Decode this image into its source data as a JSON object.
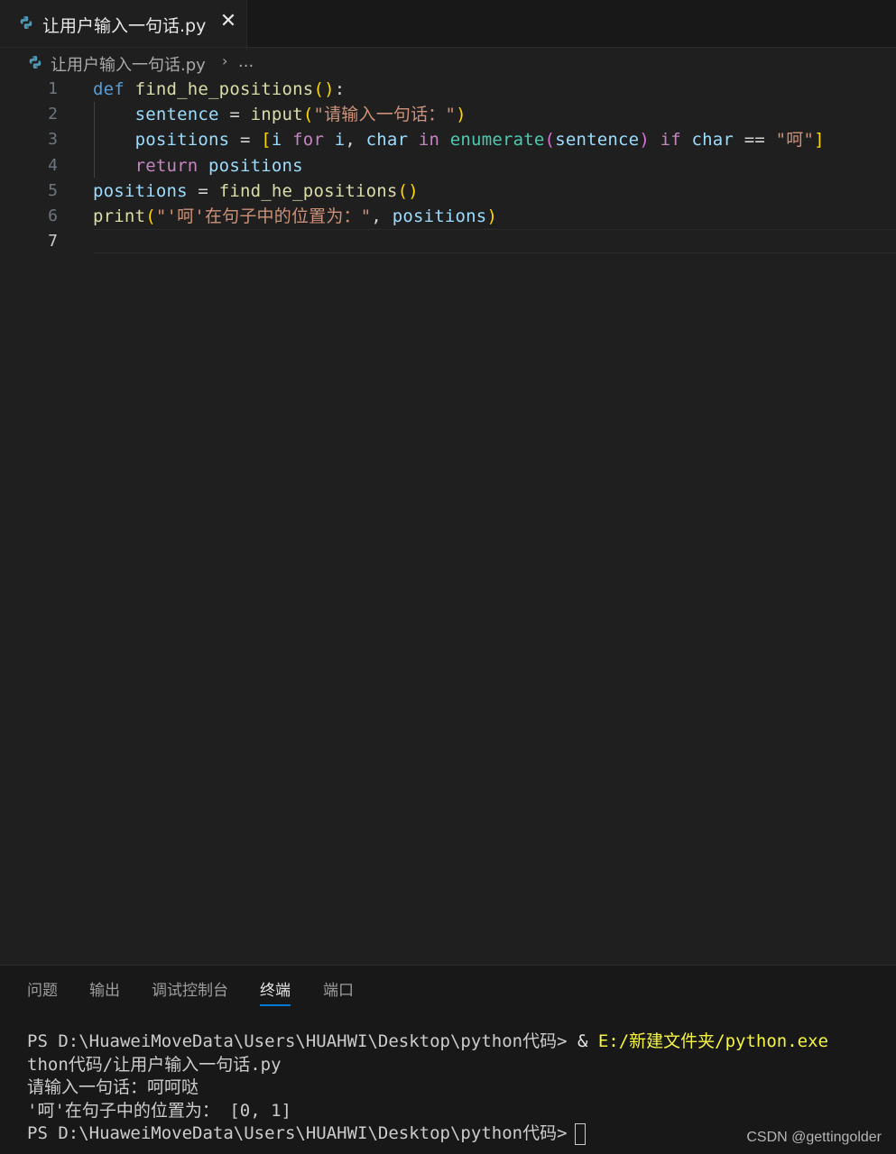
{
  "tab": {
    "filename": "让用户输入一句话.py",
    "close_glyph": "✕",
    "icon": "python-icon"
  },
  "breadcrumb": {
    "file": "让用户输入一句话.py",
    "separator": "›",
    "more": "..."
  },
  "editor": {
    "line_numbers": [
      "1",
      "2",
      "3",
      "4",
      "5",
      "6",
      "7"
    ],
    "active_line": "7",
    "lines": [
      [
        {
          "t": "def",
          "c": "kw"
        },
        {
          "t": " ",
          "c": "op"
        },
        {
          "t": "find_he_positions",
          "c": "fn"
        },
        {
          "t": "(",
          "c": "pn"
        },
        {
          "t": ")",
          "c": "pn"
        },
        {
          "t": ":",
          "c": "op"
        }
      ],
      [
        {
          "t": "    ",
          "c": "op"
        },
        {
          "t": "sentence",
          "c": "var"
        },
        {
          "t": " = ",
          "c": "op"
        },
        {
          "t": "input",
          "c": "fn"
        },
        {
          "t": "(",
          "c": "pn"
        },
        {
          "t": "\"请输入一句话：\"",
          "c": "str"
        },
        {
          "t": ")",
          "c": "pn"
        }
      ],
      [
        {
          "t": "    ",
          "c": "op"
        },
        {
          "t": "positions",
          "c": "var"
        },
        {
          "t": " = ",
          "c": "op"
        },
        {
          "t": "[",
          "c": "pn"
        },
        {
          "t": "i",
          "c": "var"
        },
        {
          "t": " ",
          "c": "op"
        },
        {
          "t": "for",
          "c": "ctl"
        },
        {
          "t": " ",
          "c": "op"
        },
        {
          "t": "i",
          "c": "var"
        },
        {
          "t": ", ",
          "c": "op"
        },
        {
          "t": "char",
          "c": "var"
        },
        {
          "t": " ",
          "c": "op"
        },
        {
          "t": "in",
          "c": "ctl"
        },
        {
          "t": " ",
          "c": "op"
        },
        {
          "t": "enumerate",
          "c": "cls"
        },
        {
          "t": "(",
          "c": "pb"
        },
        {
          "t": "sentence",
          "c": "var"
        },
        {
          "t": ")",
          "c": "pb"
        },
        {
          "t": " ",
          "c": "op"
        },
        {
          "t": "if",
          "c": "ctl"
        },
        {
          "t": " ",
          "c": "op"
        },
        {
          "t": "char",
          "c": "var"
        },
        {
          "t": " == ",
          "c": "op"
        },
        {
          "t": "\"呵\"",
          "c": "str"
        },
        {
          "t": "]",
          "c": "pn"
        }
      ],
      [
        {
          "t": "    ",
          "c": "op"
        },
        {
          "t": "return",
          "c": "ctl"
        },
        {
          "t": " ",
          "c": "op"
        },
        {
          "t": "positions",
          "c": "var"
        }
      ],
      [
        {
          "t": "positions",
          "c": "var"
        },
        {
          "t": " = ",
          "c": "op"
        },
        {
          "t": "find_he_positions",
          "c": "fn"
        },
        {
          "t": "(",
          "c": "pn"
        },
        {
          "t": ")",
          "c": "pn"
        }
      ],
      [
        {
          "t": "print",
          "c": "fn"
        },
        {
          "t": "(",
          "c": "pn"
        },
        {
          "t": "\"'呵'在句子中的位置为：\"",
          "c": "str"
        },
        {
          "t": ", ",
          "c": "op"
        },
        {
          "t": "positions",
          "c": "var"
        },
        {
          "t": ")",
          "c": "pn"
        }
      ],
      []
    ]
  },
  "panel": {
    "tabs": [
      "问题",
      "输出",
      "调试控制台",
      "终端",
      "端口"
    ],
    "active_tab": "终端"
  },
  "terminal": {
    "line1_prompt": "PS D:\\HuaweiMoveData\\Users\\HUAHWI\\Desktop\\python代码> ",
    "line1_amp": "& ",
    "line1_cmd": "E:/新建文件夹/python.exe",
    "line2": "thon代码/让用户输入一句话.py",
    "line3": "请输入一句话：呵呵哒",
    "line4": "'呵'在句子中的位置为： [0, 1]",
    "line5_prompt": "PS D:\\HuaweiMoveData\\Users\\HUAHWI\\Desktop\\python代码>"
  },
  "watermark": "CSDN @gettingolder",
  "colors": {
    "background": "#1f1f1f",
    "keyword": "#569cd6",
    "control": "#c586c0",
    "function": "#dcdcaa",
    "variable": "#9cdcfe",
    "string": "#ce9178",
    "builtin_class": "#4ec9b0",
    "bracket_gold": "#ffd700",
    "bracket_purple": "#da70d6",
    "panel_active_underline": "#0078d4"
  }
}
